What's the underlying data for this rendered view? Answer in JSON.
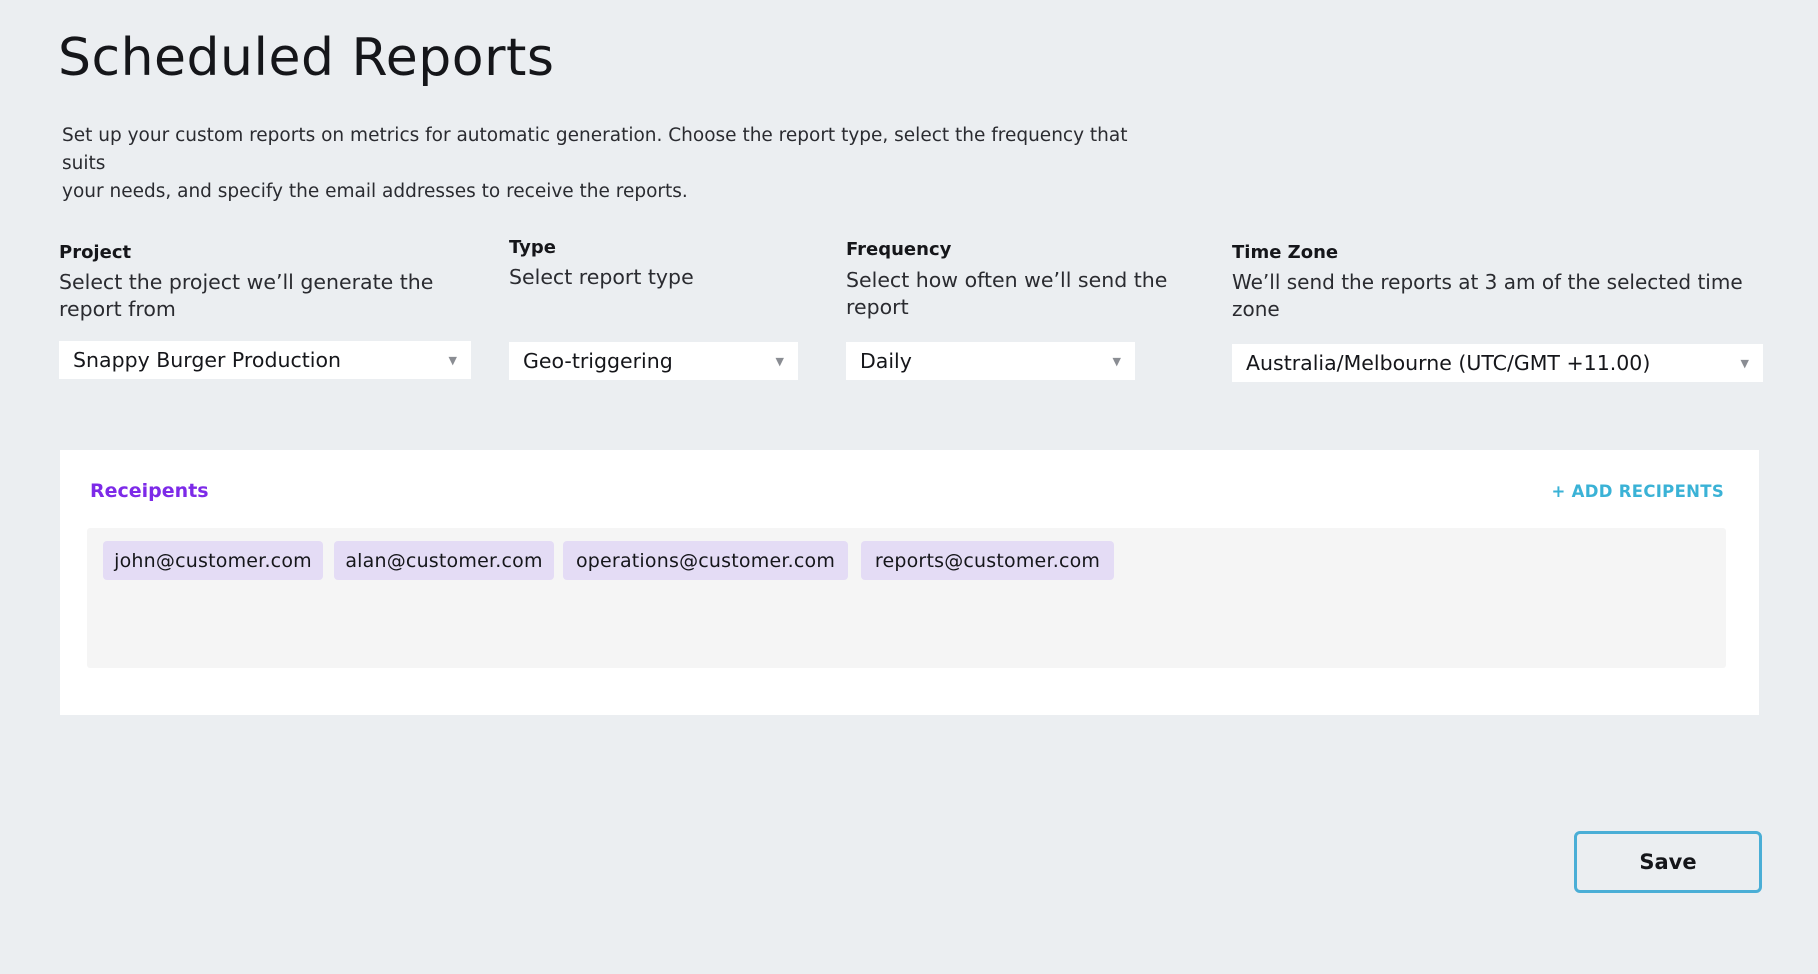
{
  "page": {
    "title": "Scheduled Reports",
    "intro_line1": "Set up your custom reports on metrics for automatic generation. Choose the report type, select the frequency that suits",
    "intro_line2": "your needs, and specify the email addresses to receive the reports."
  },
  "fields": {
    "project": {
      "label": "Project",
      "help": "Select the project we’ll generate the report from",
      "value": "Snappy Burger Production"
    },
    "type": {
      "label": "Type",
      "help": "Select report type",
      "value": "Geo-triggering"
    },
    "frequency": {
      "label": "Frequency",
      "help": "Select how often we’ll send the report",
      "value": "Daily"
    },
    "timezone": {
      "label": "Time Zone",
      "help": "We’ll send the reports at 3 am of the selected time zone",
      "value": "Australia/Melbourne (UTC/GMT +11.00)"
    },
    "dropdown_icon": "caret-down-icon"
  },
  "recipients": {
    "title": "Receipents",
    "add_label": "+ ADD RECIPENTS",
    "emails": [
      "john@customer.com",
      "alan@customer.com",
      "operations@customer.com",
      "reports@customer.com"
    ]
  },
  "actions": {
    "save_label": "Save"
  },
  "colors": {
    "background": "#ebeef1",
    "accent_purple": "#7d2ae8",
    "accent_blue": "#3ab2d6",
    "chip_bg": "#e4dcf5"
  }
}
